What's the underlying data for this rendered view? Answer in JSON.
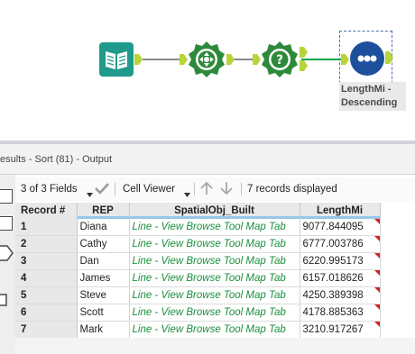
{
  "workflow": {
    "tools": [
      {
        "name": "browse-tool",
        "color": "#1e9a8a"
      },
      {
        "name": "create-points-tool",
        "color": "#2f8a3a"
      },
      {
        "name": "filter-tool",
        "color": "#2f8a3a"
      },
      {
        "name": "sort-tool",
        "color": "#1e4f9a"
      }
    ],
    "selected_tool_label": "LengthMi - Descending"
  },
  "results": {
    "title": "esults - Sort (81) - Output"
  },
  "toolbar": {
    "fields_label": "3 of 3 Fields",
    "viewer_label": "Cell Viewer",
    "records_label": "7 records displayed"
  },
  "grid": {
    "columns": [
      "Record #",
      "REP",
      "SpatialObj_Built",
      "LengthMi"
    ],
    "rows": [
      {
        "rec": "1",
        "rep": "Diana",
        "spatial": "Line - View Browse Tool Map Tab",
        "len": "9077.844095"
      },
      {
        "rec": "2",
        "rep": "Cathy",
        "spatial": "Line - View Browse Tool Map Tab",
        "len": "6777.003786"
      },
      {
        "rec": "3",
        "rep": "Dan",
        "spatial": "Line - View Browse Tool Map Tab",
        "len": "6220.995173"
      },
      {
        "rec": "4",
        "rep": "James",
        "spatial": "Line - View Browse Tool Map Tab",
        "len": "6157.018626"
      },
      {
        "rec": "5",
        "rep": "Steve",
        "spatial": "Line - View Browse Tool Map Tab",
        "len": "4250.389398"
      },
      {
        "rec": "6",
        "rep": "Scott",
        "spatial": "Line - View Browse Tool Map Tab",
        "len": "4178.885363"
      },
      {
        "rec": "7",
        "rep": "Mark",
        "spatial": "Line - View Browse Tool Map Tab",
        "len": "3210.917267"
      }
    ]
  },
  "colors": {
    "accent_green": "#1aa64a",
    "spatial_text": "#1a8f3c",
    "truncation_flag": "#d42222"
  }
}
